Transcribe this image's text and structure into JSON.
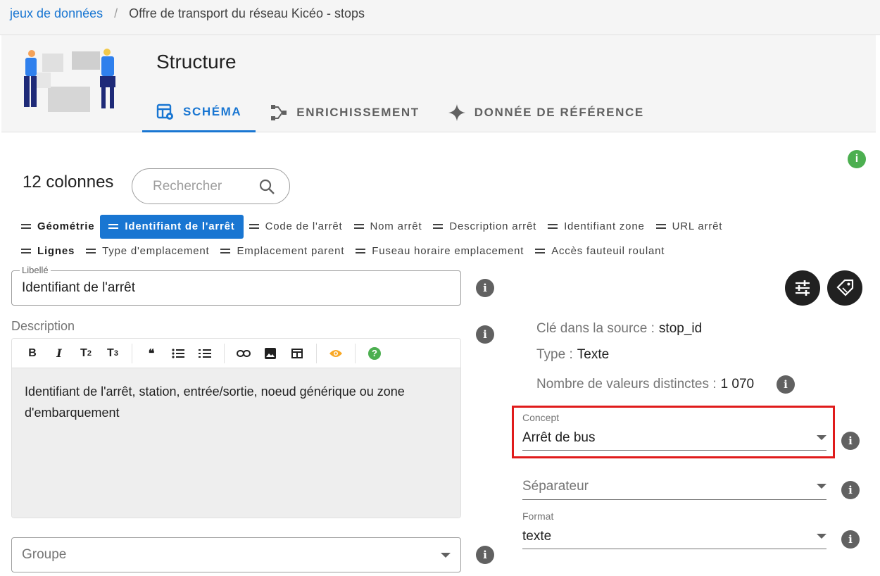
{
  "breadcrumb": {
    "root": "jeux de données",
    "separator": "/",
    "current": "Offre de transport du réseau Kicéo - stops"
  },
  "header": {
    "title": "Structure"
  },
  "tabs": [
    {
      "label": "SCHÉMA",
      "active": true
    },
    {
      "label": "ENRICHISSEMENT",
      "active": false
    },
    {
      "label": "DONNÉE DE RÉFÉRENCE",
      "active": false
    }
  ],
  "columns": {
    "count_label": "12 colonnes",
    "search_placeholder": "Rechercher"
  },
  "chips_row1": [
    "Géométrie",
    "Identifiant de l'arrêt",
    "Code de l'arrêt",
    "Nom arrêt",
    "Description arrêt",
    "Identifiant zone",
    "URL arrêt"
  ],
  "chips_row2": [
    "Lignes",
    "Type d'emplacement",
    "Emplacement parent",
    "Fuseau horaire emplacement",
    "Accès fauteuil roulant"
  ],
  "form": {
    "libelle_label": "Libellé",
    "libelle_value": "Identifiant de l'arrêt",
    "description_label": "Description",
    "description_text": "Identifiant de l'arrêt, station, entrée/sortie, noeud générique ou zone d'embarquement",
    "groupe_placeholder": "Groupe"
  },
  "toolbar": {
    "bold": "B",
    "italic": "I",
    "t2": "T",
    "t2_sub": "2",
    "t3": "T",
    "t3_sub": "3",
    "quote": "❝"
  },
  "meta": {
    "key_label": "Clé dans la source :",
    "key_value": "stop_id",
    "type_label": "Type :",
    "type_value": "Texte",
    "distinct_label": "Nombre de valeurs distinctes :",
    "distinct_value": "1 070"
  },
  "concept": {
    "label": "Concept",
    "value": "Arrêt de bus"
  },
  "separator": {
    "placeholder": "Séparateur"
  },
  "format": {
    "label": "Format",
    "value": "texte"
  },
  "info_glyph": "i",
  "help_glyph": "?",
  "colors": {
    "primary": "#1976d2",
    "highlight": "#e01b1b",
    "success": "#4caf50",
    "warning": "#f9a825"
  }
}
